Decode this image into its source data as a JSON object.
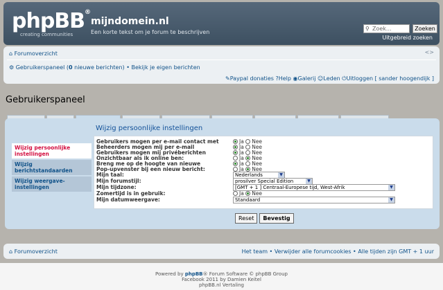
{
  "header": {
    "logo_text": "phpBB",
    "logo_reg": "®",
    "logo_tagline": "creating    communities",
    "site_title": "mijndomein.nl",
    "site_description": "Een korte tekst om je forum te beschrijven",
    "search_placeholder": "Zoek...",
    "search_button": "Zoeken",
    "advanced_search": "Uitgebreid zoeken"
  },
  "nav": {
    "forum_index": "Forumoverzicht",
    "control_panel_prefix": "Gebruikerspaneel (",
    "new_messages_count": "0",
    "new_messages_suffix": " nieuwe berichten) • Bekijk je eigen berichten",
    "links": [
      "Paypal donaties",
      "Help",
      "Galerij",
      "Leden",
      "Uitloggen [ sander hoogendijk ]"
    ]
  },
  "page": {
    "title": "Gebruikerspaneel",
    "section_title": "Wijzig persoonlijke instellingen"
  },
  "sidebar": {
    "items": [
      {
        "label": "Wijzig persoonlijke instellingen"
      },
      {
        "label": "Wijzig berichtstandaarden"
      },
      {
        "label": "Wijzig weergave-instellingen"
      }
    ]
  },
  "settings": {
    "yes": "Ja",
    "no": "Nee",
    "rows": [
      {
        "label": "Gebruikers mogen per e-mail contact met",
        "value": "Ja"
      },
      {
        "label": "Beheerders mogen mij per e-mail",
        "value": "Ja"
      },
      {
        "label": "Gebruikers mogen mij privéberichten",
        "value": "Ja"
      },
      {
        "label": "Onzichtbaar als ik online ben:",
        "value": "Nee"
      },
      {
        "label": "Breng me op de hoogte van nieuwe",
        "value": "Ja"
      },
      {
        "label": "Pop-upvenster bij een nieuw bericht:",
        "value": "Nee"
      }
    ],
    "language_label": "Mijn taal:",
    "language_value": "Nederlands",
    "style_label": "Mijn forumstijl:",
    "style_value": "prosilver Special Edition",
    "timezone_label": "Mijn tijdzone:",
    "timezone_value": "[GMT + 1 ] Centraal-Europese tijd, West-Afrik",
    "dst_label": "Zomertijd is in gebruik:",
    "dst_value": "Nee",
    "date_label": "Mijn datumweergave:",
    "date_value": "Standaard"
  },
  "buttons": {
    "reset": "Reset",
    "submit": "Bevestig"
  },
  "footer": {
    "forum_index": "Forumoverzicht",
    "right_links": "Het team • Verwijder alle forumcookies • Alle tijden zijn GMT + 1 uur",
    "credit1_pre": "Powered by ",
    "credit1_brand": "phpBB",
    "credit1_post": "® Forum Software © phpBB Group",
    "credit2": "Facebook 2011 by Damien Keitel",
    "credit3": "phpBB.nl Vertaling"
  }
}
